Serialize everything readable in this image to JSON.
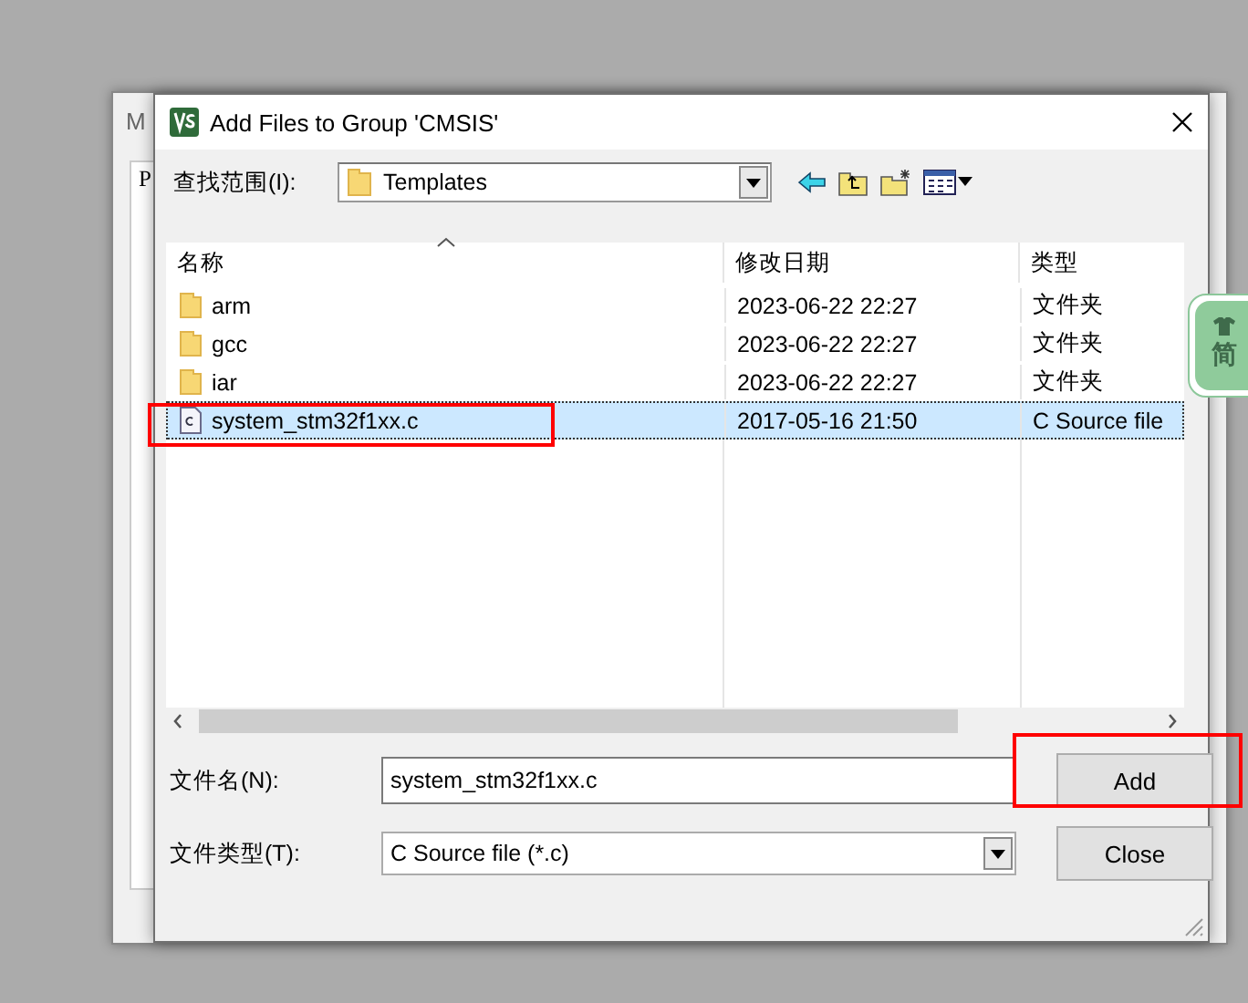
{
  "background_window": {
    "title": "M",
    "panel_label": "P"
  },
  "dialog": {
    "title": "Add Files to Group 'CMSIS'",
    "look_in": {
      "label": "查找范围(I):",
      "value": "Templates"
    },
    "file_list": {
      "columns": [
        "名称",
        "修改日期",
        "类型"
      ],
      "rows": [
        {
          "kind": "folder",
          "name": "arm",
          "date": "2023-06-22 22:27",
          "type": "文件夹",
          "selected": false,
          "highlighted": false
        },
        {
          "kind": "folder",
          "name": "gcc",
          "date": "2023-06-22 22:27",
          "type": "文件夹",
          "selected": false,
          "highlighted": false
        },
        {
          "kind": "folder",
          "name": "iar",
          "date": "2023-06-22 22:27",
          "type": "文件夹",
          "selected": false,
          "highlighted": false
        },
        {
          "kind": "c-file",
          "name": "system_stm32f1xx.c",
          "date": "2017-05-16 21:50",
          "type": "C Source file",
          "selected": true,
          "highlighted": true
        }
      ]
    },
    "file_name": {
      "label": "文件名(N):",
      "value": "system_stm32f1xx.c"
    },
    "file_type": {
      "label": "文件类型(T):",
      "value": "C Source file (*.c)"
    },
    "buttons": [
      {
        "label": "Add",
        "highlighted": true
      },
      {
        "label": "Close",
        "highlighted": false
      }
    ]
  },
  "side_tab": {
    "label": "简"
  }
}
